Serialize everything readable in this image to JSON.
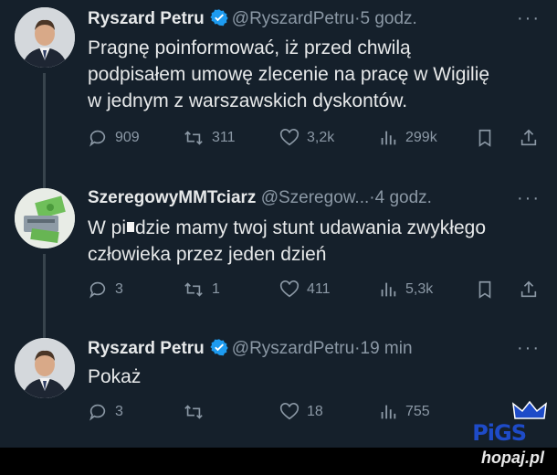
{
  "tweets": [
    {
      "name": "Ryszard Petru",
      "verified": true,
      "handle": "@RyszardPetru",
      "time": "5 godz.",
      "lines": [
        "Pragnę poinformować, iż przed chwilą",
        "podpisałem umowę zlecenie na pracę w Wigilię",
        "w jednym z warszawskich dyskontów."
      ],
      "replies": "909",
      "retweets": "311",
      "likes": "3,2k",
      "views": "299k"
    },
    {
      "name": "SzeregowyMMTciarz",
      "verified": false,
      "handle": "@Szeregow...",
      "time": "4 godz.",
      "line1_before": "W pi",
      "line1_after": "dzie mamy twoj stunt udawania zwykłego",
      "line2": "człowieka przez jeden dzień",
      "replies": "3",
      "retweets": "1",
      "likes": "411",
      "views": "5,3k"
    },
    {
      "name": "Ryszard Petru",
      "verified": true,
      "handle": "@RyszardPetru",
      "time": "19 min",
      "lines": [
        "Pokaż"
      ],
      "replies": "3",
      "retweets": "",
      "likes": "18",
      "views": "755"
    }
  ],
  "separator": "·",
  "more": "···",
  "watermark": {
    "brand": "PiGS",
    "site": "hopaj.pl"
  },
  "colors": {
    "background": "#15202b",
    "muted": "#8b98a5",
    "text": "#e7e9ea",
    "verified": "#1d9bf0"
  }
}
